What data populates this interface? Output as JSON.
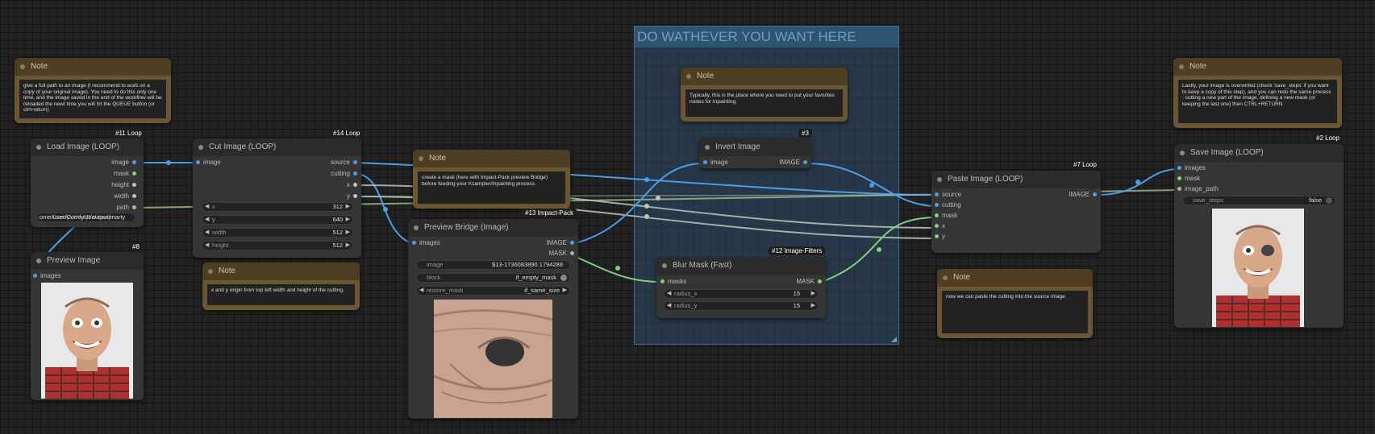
{
  "group": {
    "title": "DO WATHEVER YOU WANT HERE"
  },
  "notes": {
    "n1": {
      "title": "Note",
      "text": "give a full path to an image (I recommend to work on a copy of your original image). You need to do this only one time, and the image saved in the end of the workflow will be reloaded the newt time you will hit the QUEUE button (or ctrl+return)"
    },
    "n2": {
      "title": "Note",
      "text": "x and y origin from top left width and height of the cutting."
    },
    "n3": {
      "title": "Note",
      "text": "create a mask (here with Impact-Pack preview Bridge) before feeding your Ksampler/Inpainting process."
    },
    "n4": {
      "title": "Note",
      "text": "Typically, this is the place where you need to put your favorites nodes for Inpainting."
    },
    "n5": {
      "title": "Note",
      "text": "now we can paste the cutting into the source image"
    },
    "n6": {
      "title": "Note",
      "text": "Lastly, your image is overwrited (check 'save_steps' if you want to keep a copy of this step), and you can redo the same process : cutting a new part of the image, defining a new mask (or keeping the last one) then CTRL+RETURN"
    }
  },
  "load_image": {
    "badge": "#11 Loop",
    "title": "Load Image (LOOP)",
    "outputs": [
      "image",
      "mask",
      "height",
      "width",
      "path"
    ],
    "path_value": "ome/user/ComfyUI/output/marty",
    "path_overlay": "ComfyUI/output/marty"
  },
  "preview_image": {
    "badge": "#8",
    "title": "Preview Image",
    "input": "images"
  },
  "cut_image": {
    "badge": "#14 Loop",
    "title": "Cut Image (LOOP)",
    "input": "image",
    "outputs": [
      "source",
      "cutting",
      "x",
      "y"
    ],
    "widgets": [
      {
        "label": "x",
        "value": "312"
      },
      {
        "label": "y",
        "value": "640"
      },
      {
        "label": "width",
        "value": "512"
      },
      {
        "label": "height",
        "value": "512"
      }
    ]
  },
  "preview_bridge": {
    "badge": "#13 Impact-Pack",
    "title": "Preview Bridge (Image)",
    "input": "images",
    "outputs": [
      "IMAGE",
      "MASK"
    ],
    "widgets": {
      "image": {
        "label": "image",
        "value": "$13-1736083890.1794288"
      },
      "block": {
        "label": "block",
        "value": "if_empty_mask"
      },
      "restore": {
        "label": "restore_mask",
        "value": "if_same_size"
      }
    }
  },
  "invert_image": {
    "badge": "#3",
    "title": "Invert Image",
    "input": "image",
    "output": "IMAGE"
  },
  "blur_mask": {
    "badge": "#12 Image-Filters",
    "title": "Blur Mask (Fast)",
    "input": "masks",
    "output": "MASK",
    "widgets": [
      {
        "label": "radius_x",
        "value": "15"
      },
      {
        "label": "radius_y",
        "value": "15"
      }
    ]
  },
  "paste_image": {
    "badge": "#7 Loop",
    "title": "Paste Image (LOOP)",
    "inputs": [
      "source",
      "cutting",
      "mask",
      "x",
      "y"
    ],
    "output": "IMAGE"
  },
  "save_image": {
    "badge": "#2 Loop",
    "title": "Save Image (LOOP)",
    "inputs": [
      "images",
      "mask",
      "image_path"
    ],
    "widget": {
      "label": "save_steps",
      "value": "false"
    }
  },
  "colors": {
    "image": "#4a9ee8",
    "mask": "#7fd07f",
    "int": "#b8c8b8",
    "path": "#9fbf8f"
  }
}
